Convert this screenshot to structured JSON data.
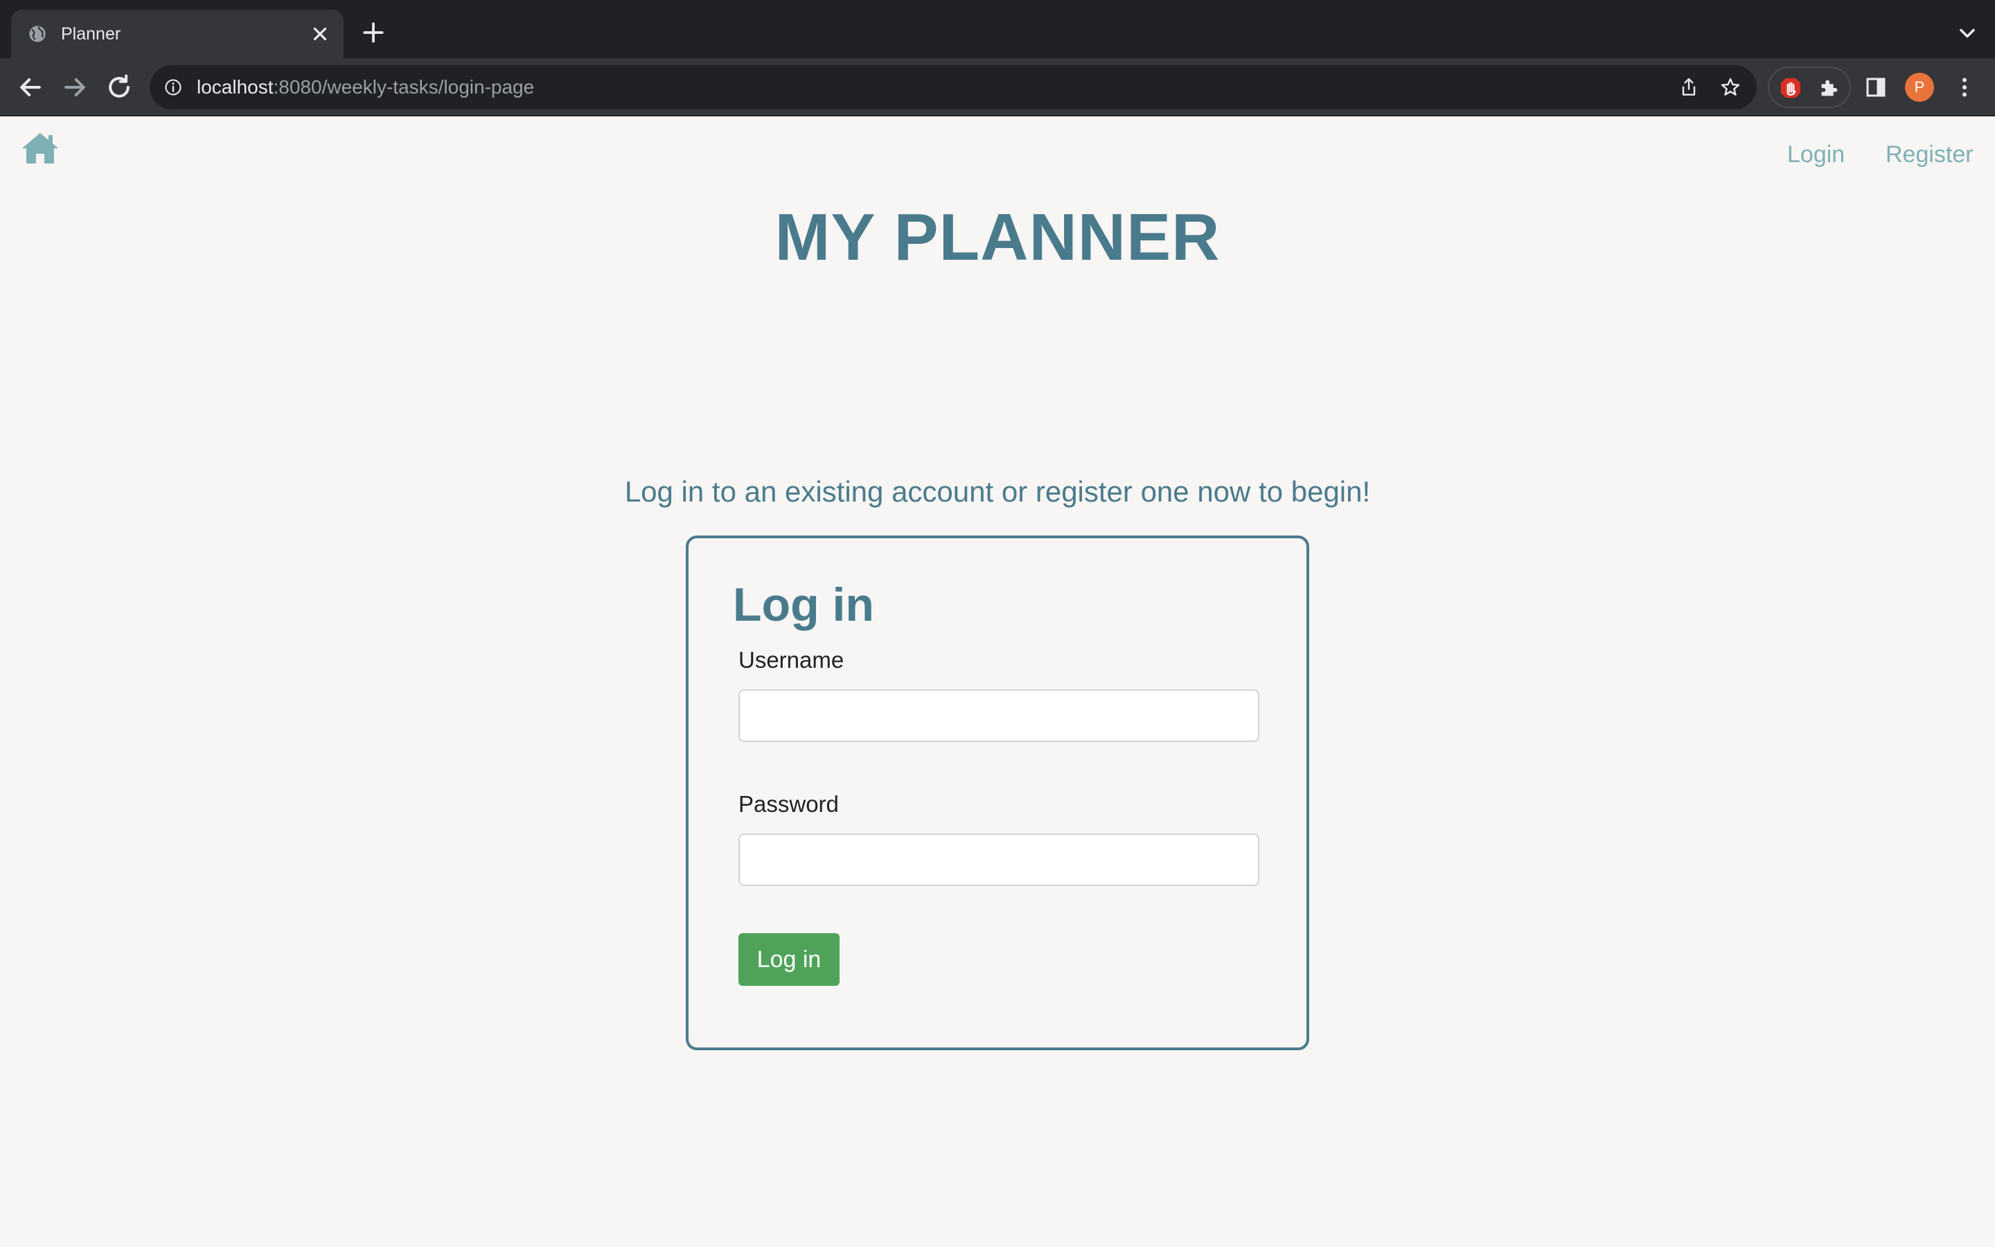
{
  "browser": {
    "tab_title": "Planner",
    "url_host": "localhost",
    "url_path": ":8080/weekly-tasks/login-page",
    "profile_initial": "P"
  },
  "nav": {
    "login_label": "Login",
    "register_label": "Register"
  },
  "page": {
    "title": "MY PLANNER",
    "intro": "Log in to an existing account or register one now to begin!"
  },
  "login_form": {
    "heading": "Log in",
    "username_label": "Username",
    "username_value": "",
    "password_label": "Password",
    "password_value": "",
    "submit_label": "Log in"
  },
  "colors": {
    "accent": "#4a7b8c",
    "nav_link": "#7fb0b5",
    "submit_button": "#4fa359",
    "background": "#f7f6f5"
  }
}
